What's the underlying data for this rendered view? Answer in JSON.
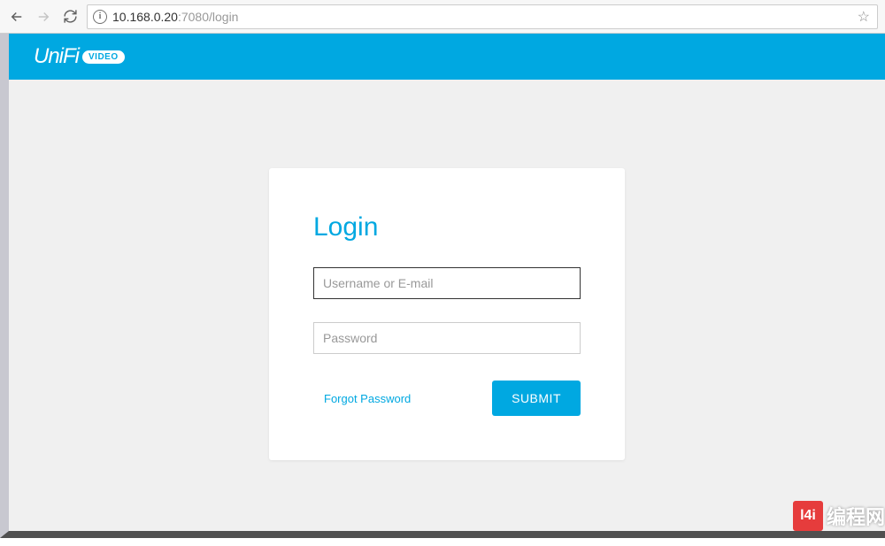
{
  "browser": {
    "url_host": "10.168.0.20",
    "url_rest": ":7080/login"
  },
  "brand": {
    "name": "UniFi",
    "badge": "VIDEO"
  },
  "login": {
    "title": "Login",
    "username_placeholder": "Username or E-mail",
    "username_value": "",
    "password_placeholder": "Password",
    "password_value": "",
    "forgot_label": "Forgot Password",
    "submit_label": "SUBMIT"
  },
  "watermark": {
    "badge": "l4i",
    "text": "编程网"
  }
}
